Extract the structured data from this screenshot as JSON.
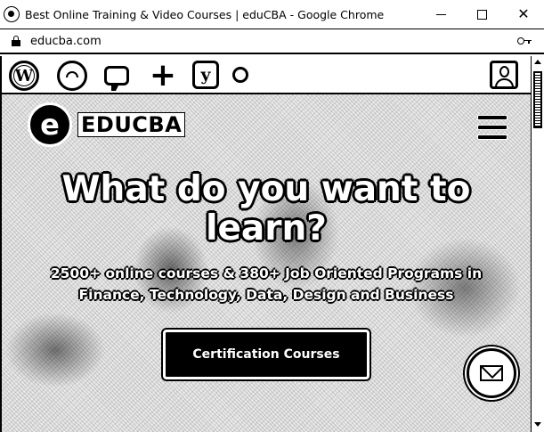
{
  "window": {
    "title": "Best Online Training & Video Courses | eduCBA - Google Chrome",
    "minimize_icon": "minimize-icon",
    "maximize_icon": "maximize-icon",
    "close_glyph": "✕"
  },
  "addressbar": {
    "url": "educba.com",
    "lock_icon": "lock-icon",
    "key_icon": "key-icon"
  },
  "wp_toolbar": {
    "icons": [
      "wordpress-icon",
      "dashboard-icon",
      "comment-icon",
      "plus-icon",
      "yoast-icon",
      "status-dot-icon",
      "user-icon"
    ],
    "wp_glyph": "W",
    "plus_glyph": "+",
    "yoast_glyph": "y"
  },
  "header": {
    "logo_letter": "e",
    "logo_text": "EDUCBA",
    "menu_icon": "hamburger-icon"
  },
  "hero": {
    "title_line1": "What do you want to",
    "title_line2": "learn?",
    "subtitle_line1": "2500+ online courses & 380+ Job Oriented Programs in",
    "subtitle_line2": "Finance, Technology, Data, Design and Business",
    "cta_label": "Certification Courses"
  },
  "widgets": {
    "mail_icon": "mail-icon"
  }
}
